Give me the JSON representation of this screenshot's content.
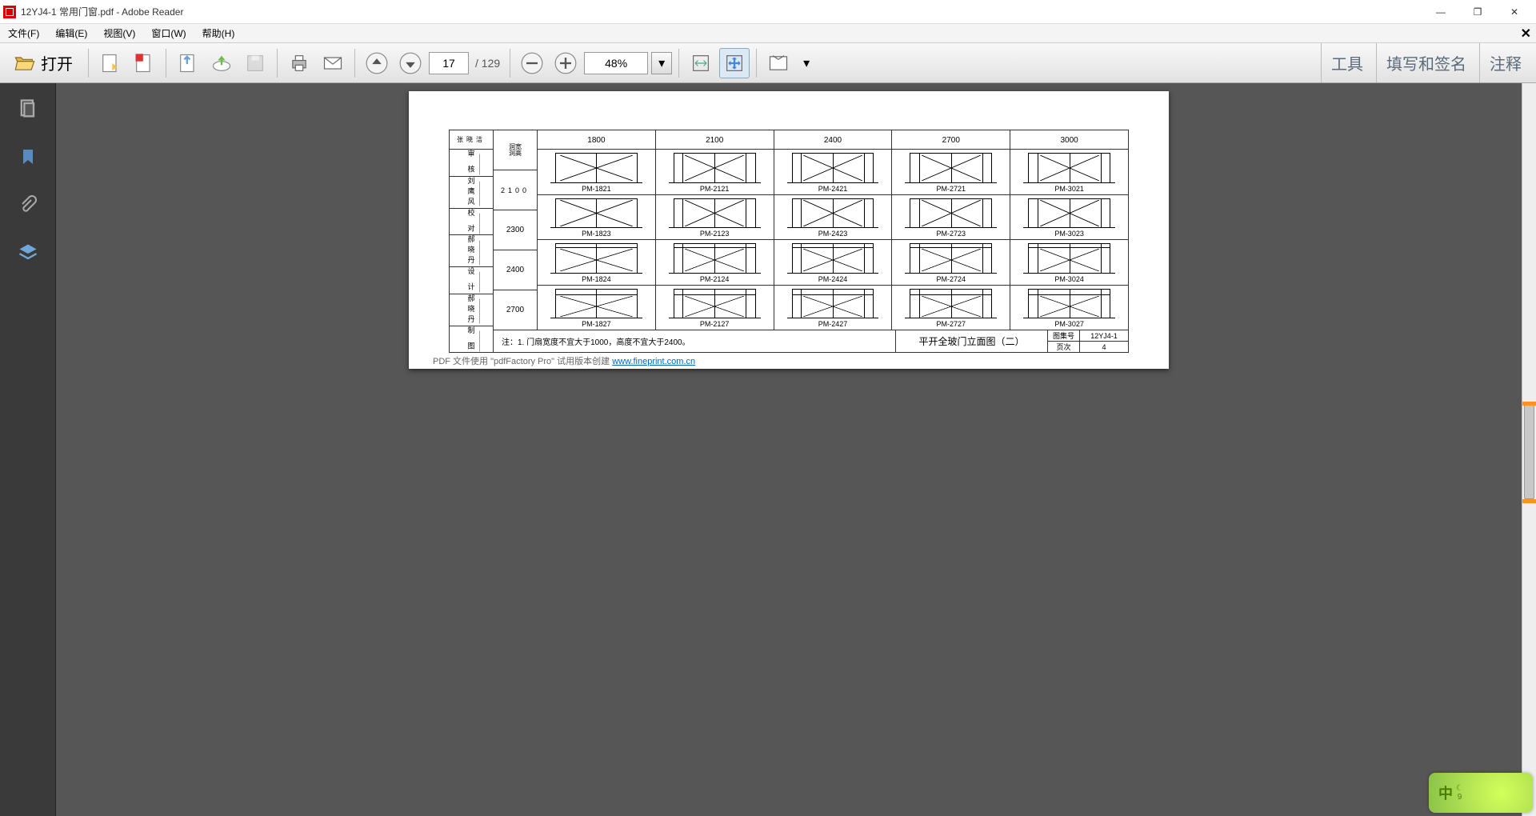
{
  "window": {
    "title": "12YJ4-1 常用门窗.pdf - Adobe Reader",
    "min": "—",
    "max": "❐",
    "close": "✕"
  },
  "menu": {
    "file": "文件(F)",
    "edit": "编辑(E)",
    "view": "视图(V)",
    "window": "窗口(W)",
    "help": "帮助(H)"
  },
  "toolbar": {
    "open": "打开",
    "page_current": "17",
    "page_total": "/ 129",
    "zoom": "48%",
    "tools": "工具",
    "fill": "填写和签名",
    "comment": "注释"
  },
  "chart_data": {
    "type": "table",
    "title": "平开全玻门立面图（二）",
    "col_header_label": "洞宽\n洞高",
    "columns": [
      "1800",
      "2100",
      "2400",
      "2700",
      "3000"
    ],
    "rows": [
      "2100",
      "2300",
      "2400",
      "2700"
    ],
    "cells": [
      [
        "PM-1821",
        "PM-2121",
        "PM-2421",
        "PM-2721",
        "PM-3021"
      ],
      [
        "PM-1823",
        "PM-2123",
        "PM-2423",
        "PM-2723",
        "PM-3023"
      ],
      [
        "PM-1824",
        "PM-2124",
        "PM-2424",
        "PM-2724",
        "PM-3024"
      ],
      [
        "PM-1827",
        "PM-2127",
        "PM-2427",
        "PM-2727",
        "PM-3027"
      ]
    ],
    "left_labels": [
      "张晓洁",
      "审 核",
      "刘鹰风",
      "校 对",
      "郝晓丹",
      "设 计",
      "郝晓丹",
      "制 图"
    ],
    "note": "注：1. 门扇宽度不宜大于1000，高度不宜大于2400。",
    "titleblock": {
      "code_label": "图集号",
      "code": "12YJ4-1",
      "page_label": "页次",
      "page": "4"
    }
  },
  "footer": {
    "prefix": "PDF 文件使用 \"pdfFactory Pro\" 试用版本创建 ",
    "link": "www.fineprint.com.cn"
  },
  "ime": {
    "lang": "中",
    "moon": "☾",
    "num": "9"
  }
}
